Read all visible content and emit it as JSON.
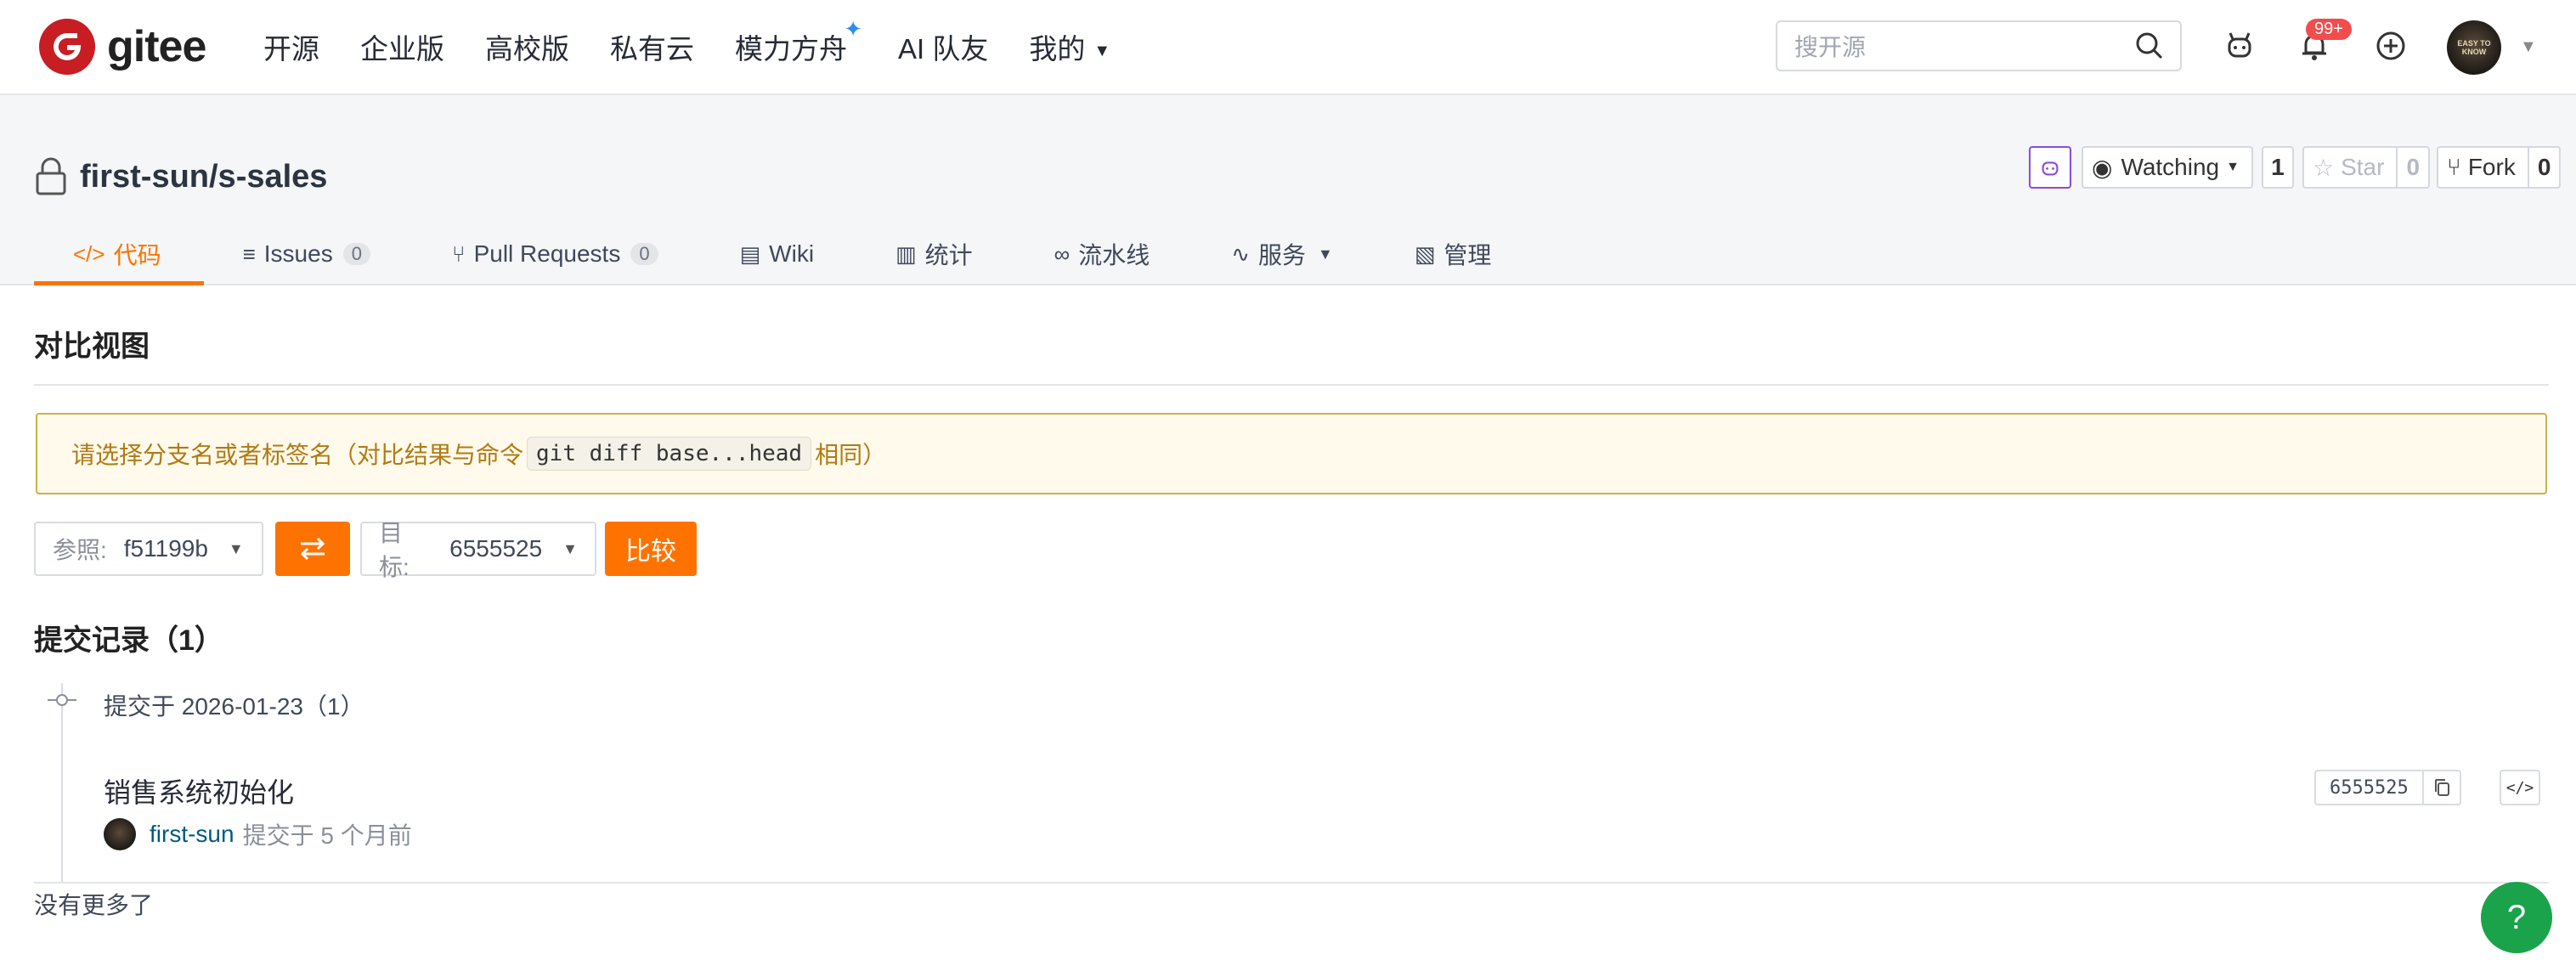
{
  "header": {
    "logo_text": "gitee",
    "nav": [
      "开源",
      "企业版",
      "高校版",
      "私有云",
      "模力方舟",
      "AI 队友",
      "我的"
    ],
    "search_placeholder": "搜开源",
    "notification_badge": "99+",
    "avatar_text": "EASY TO KNOW"
  },
  "repo": {
    "title": "first-sun/s-sales",
    "watch_label": "Watching",
    "watch_count": "1",
    "star_label": "Star",
    "star_count": "0",
    "fork_label": "Fork",
    "fork_count": "0",
    "tabs": [
      {
        "icon": "</>",
        "label": "代码"
      },
      {
        "icon": "≡",
        "label": "Issues",
        "count": "0"
      },
      {
        "icon": "⑂",
        "label": "Pull Requests",
        "count": "0"
      },
      {
        "icon": "▤",
        "label": "Wiki"
      },
      {
        "icon": "▥",
        "label": "统计"
      },
      {
        "icon": "∞",
        "label": "流水线"
      },
      {
        "icon": "∿",
        "label": "服务"
      },
      {
        "icon": "▧",
        "label": "管理"
      }
    ]
  },
  "compare": {
    "title": "对比视图",
    "notice_before": "请选择分支名或者标签名（对比结果与命令",
    "notice_code": "git diff base...head",
    "notice_after": "相同）",
    "base_label": "参照:",
    "base_value": "f51199b",
    "target_label": "目标:",
    "target_value": "6555525",
    "compare_button": "比较",
    "commits_title": "提交记录（1）",
    "day_header": "提交于 2026-01-23（1）",
    "commit": {
      "message": "销售系统初始化",
      "author": "first-sun",
      "time": "提交于 5 个月前",
      "sha": "6555525"
    },
    "no_more": "没有更多了"
  },
  "colors": {
    "accent": "#fe7300",
    "brand": "#c71d23",
    "notice_text": "#b07a14",
    "help": "#1aa34a"
  }
}
